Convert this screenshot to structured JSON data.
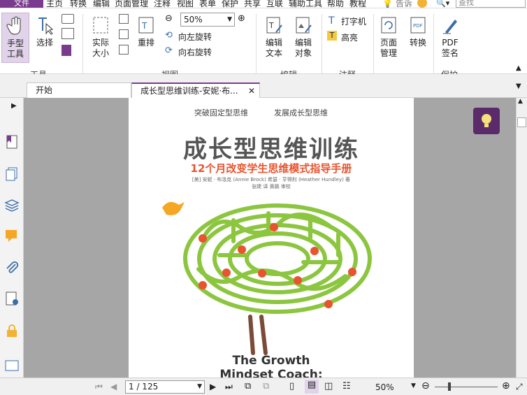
{
  "menu": {
    "file": "文件",
    "items": [
      "主页",
      "转换",
      "编辑",
      "页面管理",
      "注释",
      "视图",
      "表单",
      "保护",
      "共享",
      "互联",
      "辅助工具",
      "帮助",
      "教程"
    ],
    "tell_me": "告诉",
    "search_placeholder": "查找"
  },
  "ribbon": {
    "hand_tool": "手型\n工具",
    "select": "选择",
    "actual_size": "实际\n大小",
    "reflow": "重排",
    "zoom_value": "50%",
    "rotate_left": "向左旋转",
    "rotate_right": "向右旋转",
    "edit_text": "编辑\n文本",
    "edit_object": "编辑\n对象",
    "typewriter": "打字机",
    "highlight": "高亮",
    "page_manage": "页面\n管理",
    "convert": "转换",
    "pdf_sign": "PDF\n签名",
    "groups": {
      "tools": "工具",
      "view": "视图",
      "edit": "编辑",
      "comment": "注释",
      "protect": "保护"
    }
  },
  "tabs": [
    "开始",
    "成长型思维训练-安妮·布..."
  ],
  "page": {
    "tagline_left": "突破固定型思维",
    "tagline_right": "发展成长型思维",
    "title": "成长型思维训练",
    "subtitle": "12个月改变学生思维模式指导手册",
    "authors": "[美] 安妮 · 布洛克 (Annie Brock)  希瑟 · 亨得利 (Heather Hundley)  著",
    "translators": "张婕  译   黄鹂  审校",
    "en_title_1": "The Growth",
    "en_title_2": "Mindset Coach:"
  },
  "status": {
    "page_indicator": "1 / 125",
    "zoom": "50%"
  },
  "colors": {
    "accent": "#7a3b8f",
    "tree_green": "#8cc63f",
    "subtitle_red": "#e8542f",
    "trunk": "#7b4b3a"
  }
}
